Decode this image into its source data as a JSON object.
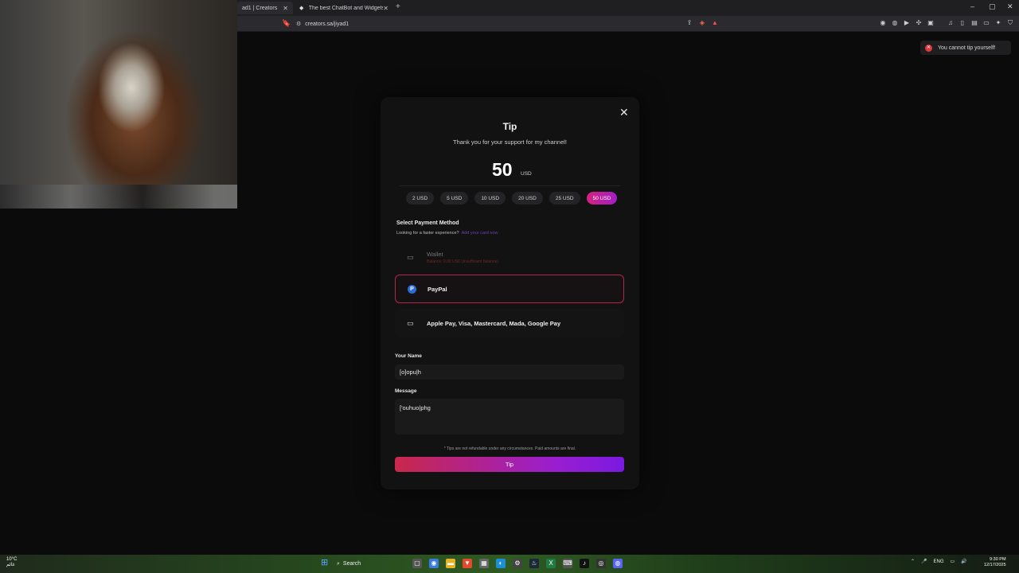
{
  "browser": {
    "tabs": [
      {
        "title": "ad1 | Creators",
        "active": true
      },
      {
        "title": "The best ChatBot and Widgets for Ki",
        "active": false
      }
    ],
    "new_tab": "+",
    "window_controls": [
      "–",
      "▢",
      "✕"
    ],
    "url": "creators.sa/jiyad1"
  },
  "toast": {
    "message": "You cannot tip yourself!",
    "type": "error",
    "color": "#e03a3a"
  },
  "modal": {
    "title": "Tip",
    "subtitle": "Thank you for your support for my channel!",
    "amount": "50",
    "currency": "USD",
    "presets": [
      {
        "label": "2 USD",
        "selected": false
      },
      {
        "label": "5 USD",
        "selected": false
      },
      {
        "label": "10 USD",
        "selected": false
      },
      {
        "label": "20 USD",
        "selected": false
      },
      {
        "label": "25 USD",
        "selected": false
      },
      {
        "label": "50 USD",
        "selected": true
      }
    ],
    "payment_method_label": "Select Payment Method",
    "payment_hint": "Looking for a faster experience?",
    "payment_hint_link": "Add your card now",
    "methods": [
      {
        "name": "Wallet",
        "sub": "Balance: 0.00 USD (Insufficient balance)",
        "icon": "wallet-icon",
        "disabled": true
      },
      {
        "name": "PayPal",
        "icon": "paypal-icon",
        "selected": true
      },
      {
        "name": "Apple Pay, Visa, Mastercard, Mada, Google Pay",
        "icon": "credit-card-icon",
        "selected": false
      }
    ],
    "name_label": "Your Name",
    "name_value": "[o]opu|h",
    "message_label": "Message",
    "message_value": "['ouhuo|phg",
    "notice": "* Tips are not refundable under any circumstances. Paid amounts are final.",
    "submit_label": "Tip",
    "accent_gradient": [
      "#d4237e",
      "#a51dc7"
    ]
  },
  "taskbar": {
    "weather_temp": "10°C",
    "weather_desc": "غائم",
    "search_label": "Search",
    "language": "ENG",
    "time": "9:30 PM",
    "date": "12/17/2025"
  }
}
